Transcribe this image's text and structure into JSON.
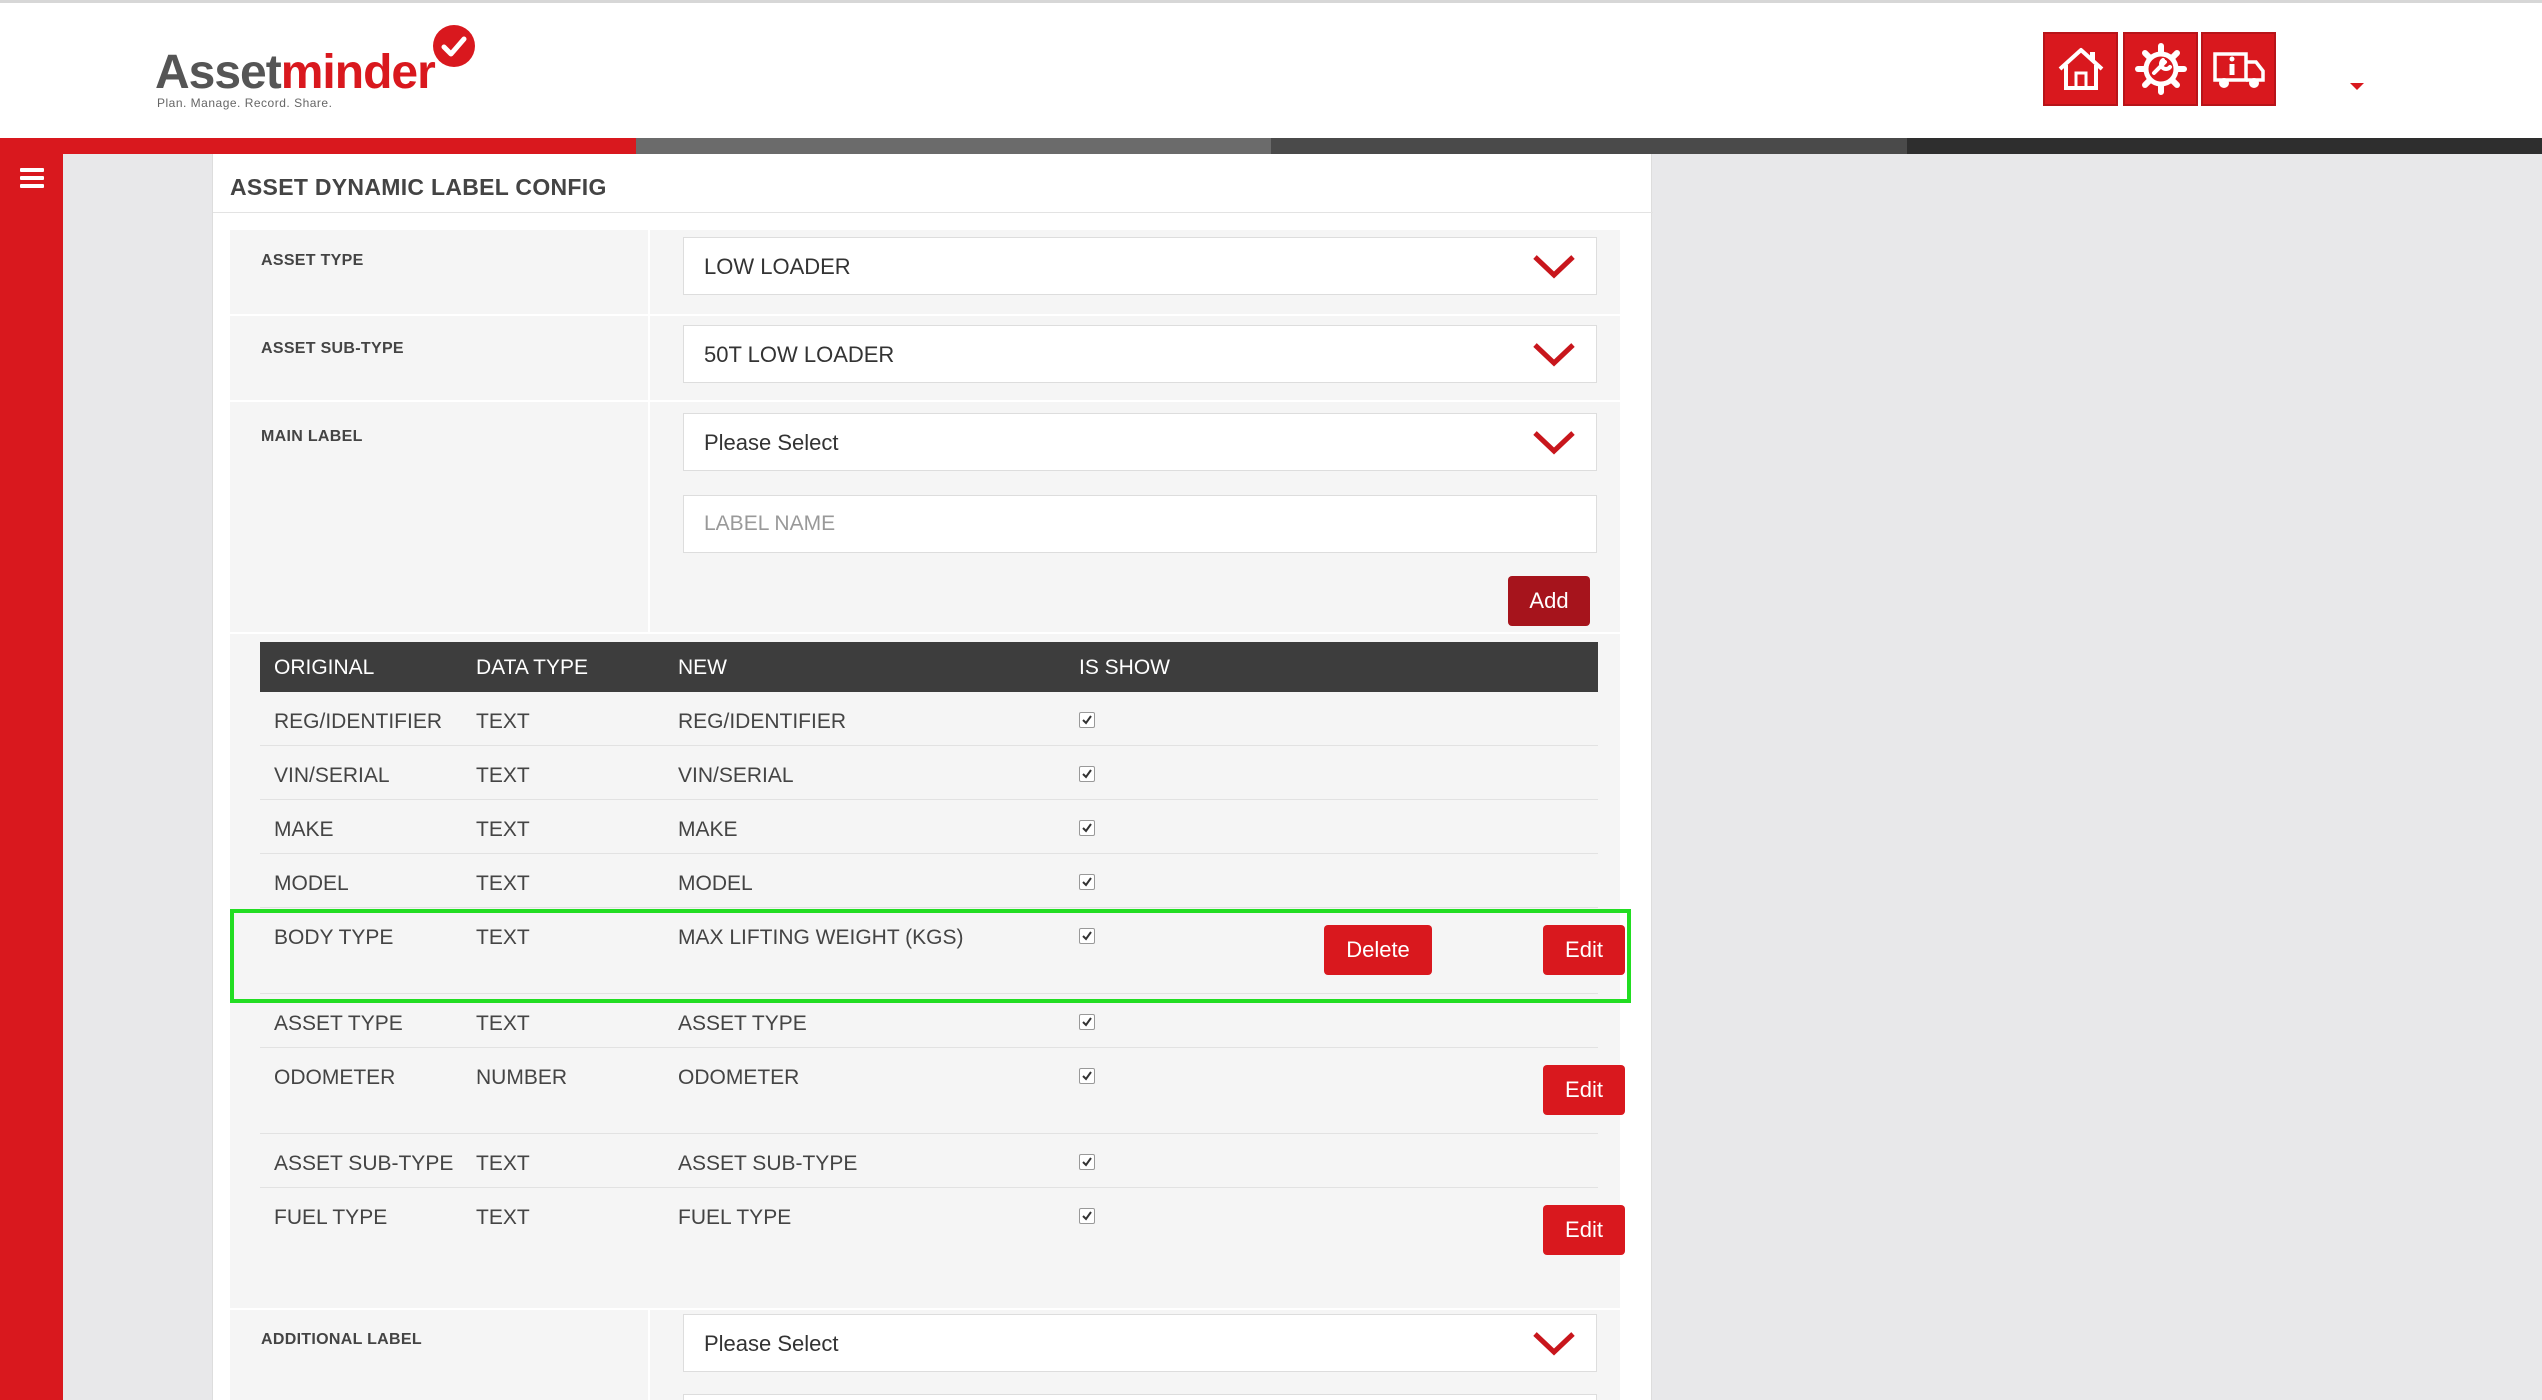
{
  "app": {
    "logo_main_a": "Asset",
    "logo_main_b": "minder",
    "logo_tagline": "Plan. Manage. Record. Share."
  },
  "header_icons": [
    "home-icon",
    "service-gear-icon",
    "vehicle-info-icon"
  ],
  "colors": {
    "brand_red": "#d9181e",
    "dark_red": "#a6141c",
    "header_dark": "#3d3d3d",
    "highlight": "#22dd22",
    "colorbar": [
      "#d9181e",
      "#6b6b6b",
      "#4a4a4a",
      "#2e2e2e"
    ]
  },
  "page": {
    "title": "ASSET DYNAMIC LABEL CONFIG"
  },
  "form": {
    "asset_type": {
      "label": "ASSET TYPE",
      "value": "LOW LOADER"
    },
    "asset_sub_type": {
      "label": "ASSET SUB-TYPE",
      "value": "50T LOW LOADER"
    },
    "main_label": {
      "label": "MAIN LABEL",
      "value": "Please Select"
    },
    "label_name": {
      "placeholder": "LABEL NAME"
    },
    "add_button": "Add",
    "additional_label": {
      "label": "ADDITIONAL LABEL",
      "value": "Please Select"
    }
  },
  "table": {
    "headers": [
      "ORIGINAL",
      "DATA TYPE",
      "NEW",
      "IS SHOW"
    ],
    "rows": [
      {
        "original": "REG/IDENTIFIER",
        "data_type": "TEXT",
        "new": "REG/IDENTIFIER",
        "is_show": true
      },
      {
        "original": "VIN/SERIAL",
        "data_type": "TEXT",
        "new": "VIN/SERIAL",
        "is_show": true
      },
      {
        "original": "MAKE",
        "data_type": "TEXT",
        "new": "MAKE",
        "is_show": true
      },
      {
        "original": "MODEL",
        "data_type": "TEXT",
        "new": "MODEL",
        "is_show": true
      },
      {
        "original": "BODY TYPE",
        "data_type": "TEXT",
        "new": "MAX LIFTING WEIGHT (KGS)",
        "is_show": true,
        "delete_label": "Delete",
        "edit_label": "Edit"
      },
      {
        "original": "ASSET TYPE",
        "data_type": "TEXT",
        "new": "ASSET TYPE",
        "is_show": true
      },
      {
        "original": "ODOMETER",
        "data_type": "NUMBER",
        "new": "ODOMETER",
        "is_show": true,
        "edit_label": "Edit"
      },
      {
        "original": "ASSET SUB-TYPE",
        "data_type": "TEXT",
        "new": "ASSET SUB-TYPE",
        "is_show": true
      },
      {
        "original": "FUEL TYPE",
        "data_type": "TEXT",
        "new": "FUEL TYPE",
        "is_show": true,
        "edit_label": "Edit"
      }
    ]
  }
}
